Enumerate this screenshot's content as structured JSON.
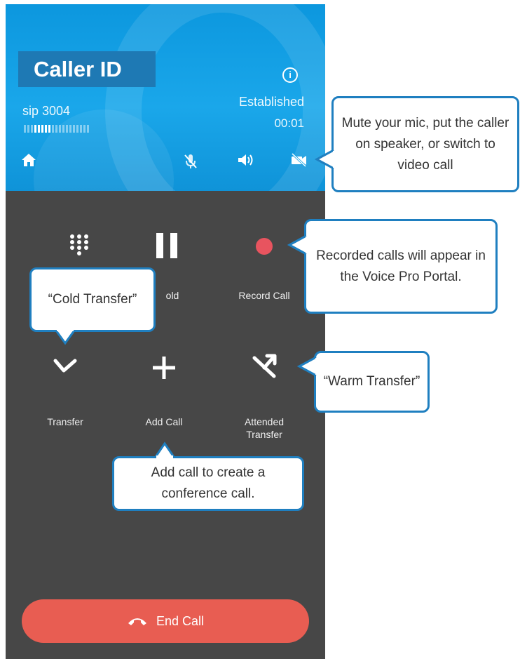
{
  "header": {
    "caller_id": "Caller ID",
    "sip": "sip 3004",
    "status": "Established",
    "timer": "00:01"
  },
  "actions": {
    "keypad_label": "",
    "hold_label": "old",
    "record_label": "Record Call",
    "transfer_label": "Transfer",
    "add_call_label": "Add Call",
    "attended_transfer_label": "Attended Transfer"
  },
  "end_call": {
    "label": "End Call"
  },
  "callouts": {
    "media_controls": "Mute your mic, put the caller on speaker, or switch to video call",
    "record": "Recorded calls will appear in the Voice Pro Portal.",
    "cold_transfer": "“Cold Transfer”",
    "warm_transfer": "“Warm Transfer”",
    "add_call": "Add call to create a conference call."
  },
  "colors": {
    "header_blue": "#1aa7ea",
    "panel_gray": "#474747",
    "record_red": "#e8545f",
    "end_call_red": "#e85d52",
    "callout_border": "#1f7fc0"
  },
  "icons": [
    "home-icon",
    "mic-off-icon",
    "speaker-icon",
    "video-off-icon",
    "info-icon",
    "keypad-icon",
    "pause-icon",
    "record-icon",
    "transfer-icon",
    "plus-icon",
    "attended-transfer-icon",
    "phone-hangup-icon"
  ]
}
